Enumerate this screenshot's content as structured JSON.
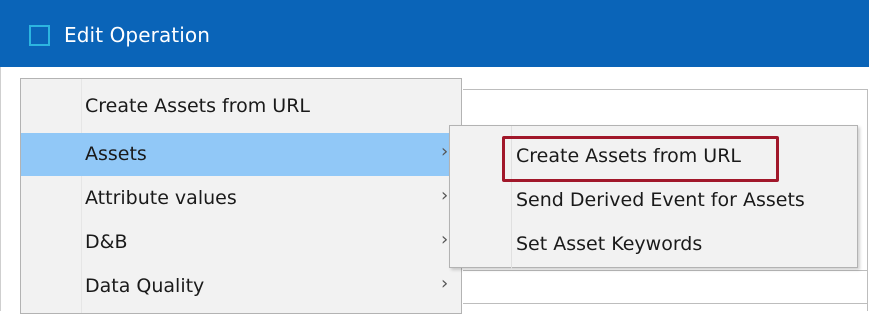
{
  "window": {
    "title": "Edit Operation"
  },
  "context_menu": {
    "items": [
      {
        "label": "Create Assets from URL",
        "has_submenu": false
      },
      {
        "label": "Assets",
        "has_submenu": true,
        "highlighted": true
      },
      {
        "label": "Attribute values",
        "has_submenu": true
      },
      {
        "label": "D&B",
        "has_submenu": true
      },
      {
        "label": "Data Quality",
        "has_submenu": true
      }
    ],
    "arrow_glyph": "›"
  },
  "submenu": {
    "items": [
      {
        "label": "Create Assets from URL",
        "emphasized": true
      },
      {
        "label": "Send Derived Event for Assets"
      },
      {
        "label": "Set Asset Keywords"
      }
    ]
  },
  "colors": {
    "titlebar": "#0a64b8",
    "highlight": "#91c8f7",
    "emphasis_box": "#a1172a"
  }
}
